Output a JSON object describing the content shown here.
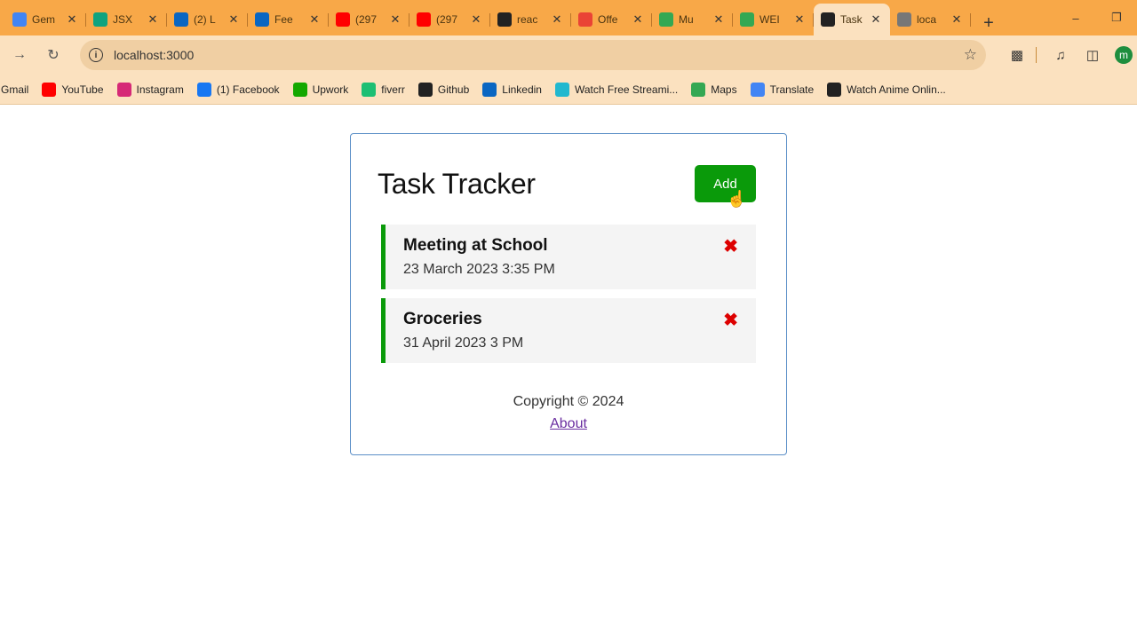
{
  "browser": {
    "tabs": [
      {
        "title": "Gem",
        "icon": "gemini-icon",
        "color": "#4285f4"
      },
      {
        "title": "JSX",
        "icon": "openai-icon",
        "color": "#10a37f"
      },
      {
        "title": "(2) L",
        "icon": "linkedin-icon",
        "color": "#0a66c2"
      },
      {
        "title": "Fee",
        "icon": "linkedin-icon",
        "color": "#0a66c2"
      },
      {
        "title": "(297",
        "icon": "youtube-icon",
        "color": "#ff0000"
      },
      {
        "title": "(297",
        "icon": "youtube-icon",
        "color": "#ff0000"
      },
      {
        "title": "reac",
        "icon": "github-icon",
        "color": "#222222"
      },
      {
        "title": "Offe",
        "icon": "gmail-icon",
        "color": "#ea4335"
      },
      {
        "title": "Mu",
        "icon": "google-drive-icon",
        "color": "#34a853"
      },
      {
        "title": "WEI",
        "icon": "google-drive-icon",
        "color": "#34a853"
      },
      {
        "title": "Task",
        "icon": "react-icon",
        "color": "#222222",
        "active": true
      },
      {
        "title": "loca",
        "icon": "globe-icon",
        "color": "#777777"
      }
    ],
    "url": "localhost:3000",
    "profile_initial": "m",
    "bookmarks": [
      {
        "label": "Gmail",
        "icon": "none",
        "color": ""
      },
      {
        "label": "YouTube",
        "icon": "youtube-icon",
        "color": "#ff0000"
      },
      {
        "label": "Instagram",
        "icon": "instagram-icon",
        "color": "#d62976"
      },
      {
        "label": "(1) Facebook",
        "icon": "facebook-icon",
        "color": "#1877f2"
      },
      {
        "label": "Upwork",
        "icon": "upwork-icon",
        "color": "#14a800"
      },
      {
        "label": "fiverr",
        "icon": "fiverr-icon",
        "color": "#1dbf73"
      },
      {
        "label": "Github",
        "icon": "github-icon",
        "color": "#222222"
      },
      {
        "label": "Linkedin",
        "icon": "linkedin-icon",
        "color": "#0a66c2"
      },
      {
        "label": "Watch Free Streami...",
        "icon": "play-icon",
        "color": "#22b8cf"
      },
      {
        "label": "Maps",
        "icon": "maps-icon",
        "color": "#34a853"
      },
      {
        "label": "Translate",
        "icon": "translate-icon",
        "color": "#4285f4"
      },
      {
        "label": "Watch Anime Onlin...",
        "icon": "anime-icon",
        "color": "#222222"
      }
    ]
  },
  "app": {
    "title": "Task Tracker",
    "add_label": "Add",
    "tasks": [
      {
        "text": "Meeting at School",
        "day": "23 March 2023 3:35 PM"
      },
      {
        "text": "Groceries",
        "day": "31 April 2023 3 PM"
      }
    ],
    "delete_symbol": "✖",
    "copyright": "Copyright © 2024",
    "about_label": "About"
  },
  "colors": {
    "accent": "#0a9a0a",
    "delete": "#dd0000",
    "chrome": "#f8a848"
  }
}
